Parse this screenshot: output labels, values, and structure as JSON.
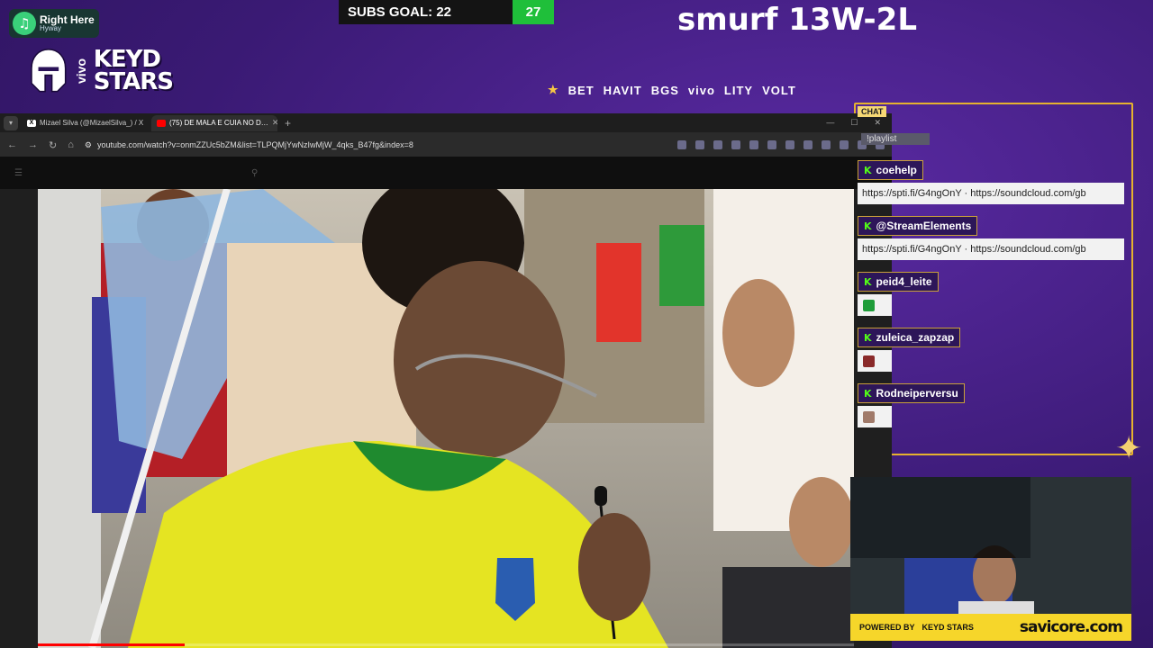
{
  "now_playing": {
    "title": "Right Here",
    "artist": "Hyway",
    "icon": "music-note-icon"
  },
  "logo": {
    "vivo": "vivo",
    "line1": "KEYD",
    "line2": "STARS"
  },
  "subs_goal": {
    "label": "SUBS GOAL: 22",
    "count": "27"
  },
  "record": "smurf 13W-2L",
  "sponsors": [
    "BET",
    "HAVIT",
    "BGS",
    "vivo",
    "LITY",
    "VOLT"
  ],
  "browser": {
    "tabs": [
      {
        "label": "Mizael Silva (@MizaelSilva_) / X",
        "favicon": "x-logo-icon",
        "active": false
      },
      {
        "label": "(75) DE MALA E CUIA NO D…",
        "favicon": "youtube-icon",
        "active": true
      }
    ],
    "url": "youtube.com/watch?v=onmZZUc5bZM&list=TLPQMjYwNzIwMjW_4qks_B47fg&index=8",
    "progress": 0.18
  },
  "chat": {
    "header": "CHAT",
    "playlist_tag": "!playlist",
    "messages": [
      {
        "user": "coehelp",
        "text": "https://spti.fi/G4ngOnY  ·  https://soundcloud.com/gb"
      },
      {
        "user": "@StreamElements",
        "text": "https://spti.fi/G4ngOnY  ·  https://soundcloud.com/gb"
      },
      {
        "user": "peid4_leite",
        "emote_color": "#1f9d3a"
      },
      {
        "user": "zuleica_zapzap",
        "emote_color": "#8a2a2a"
      },
      {
        "user": "Rodneiperversu",
        "emote_color": "#a07a6a"
      }
    ]
  },
  "webcam": {
    "powered_label": "POWERED BY",
    "powered_logo": "KEYD STARS",
    "brand": "savicore.com"
  },
  "colors": {
    "accent_gold": "#e6b22e",
    "kick_green": "#53fc18",
    "subs_green": "#1fbf3a"
  }
}
